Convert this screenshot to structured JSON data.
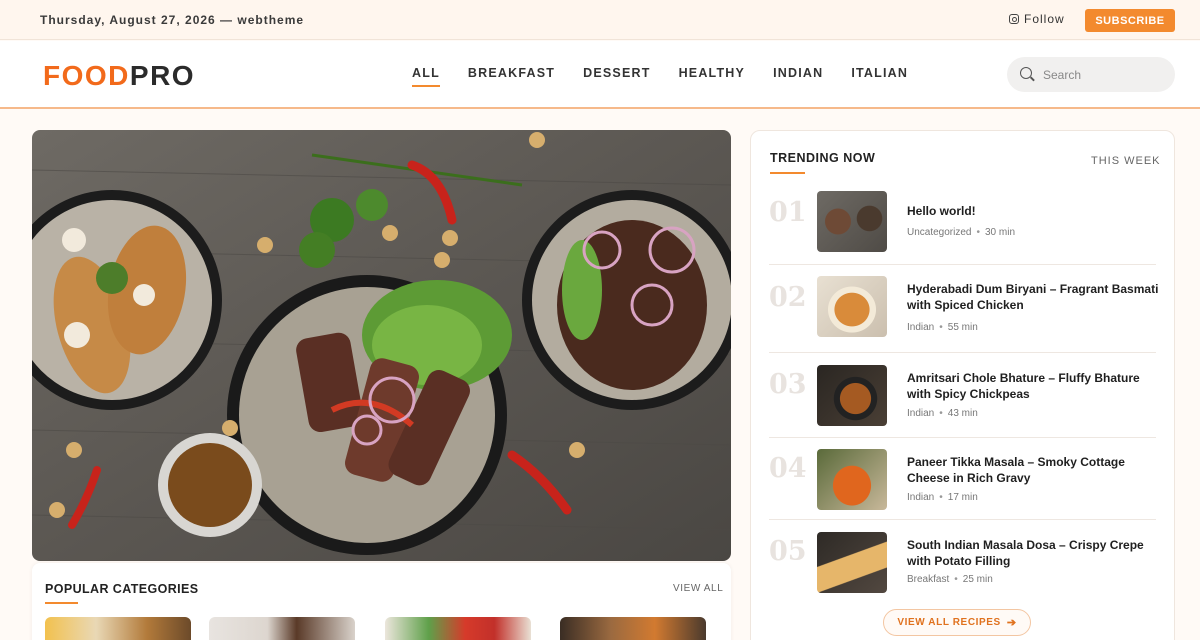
{
  "topbar": {
    "date": "Thursday, August 27, 2026 — webtheme",
    "follow_label": "Follow",
    "subscribe_label": "SUBSCRIBE",
    "follow_icon": "instagram-icon"
  },
  "header": {
    "logo_food": "FOOD",
    "logo_pro": "PRO",
    "nav": [
      "ALL",
      "BREAKFAST",
      "DESSERT",
      "HEALTHY",
      "INDIAN",
      "ITALIAN"
    ],
    "active_nav": "ALL",
    "search_placeholder": "Search",
    "search_value": ""
  },
  "popular": {
    "title": "POPULAR CATEGORIES",
    "view_all": "VIEW ALL"
  },
  "trending": {
    "title": "TRENDING NOW",
    "period": "THIS WEEK",
    "items": [
      {
        "num": "01",
        "title": "Hello world!",
        "category": "Uncategorized",
        "time": "30 min"
      },
      {
        "num": "02",
        "title": "Hyderabadi Dum Biryani – Fragrant Basmati with Spiced Chicken",
        "category": "Indian",
        "time": "55 min"
      },
      {
        "num": "03",
        "title": "Amritsari Chole Bhature – Fluffy Bhature with Spicy Chickpeas",
        "category": "Indian",
        "time": "43 min"
      },
      {
        "num": "04",
        "title": "Paneer Tikka Masala – Smoky Cottage Cheese in Rich Gravy",
        "category": "Indian",
        "time": "17 min"
      },
      {
        "num": "05",
        "title": "South Indian Masala Dosa – Crispy Crepe with Potato Filling",
        "category": "Breakfast",
        "time": "25 min"
      }
    ],
    "view_all_recipes": "VIEW ALL RECIPES"
  },
  "colors": {
    "accent": "#f38a2e",
    "logo_orange": "#f26a1b",
    "background": "#fffaf6"
  }
}
